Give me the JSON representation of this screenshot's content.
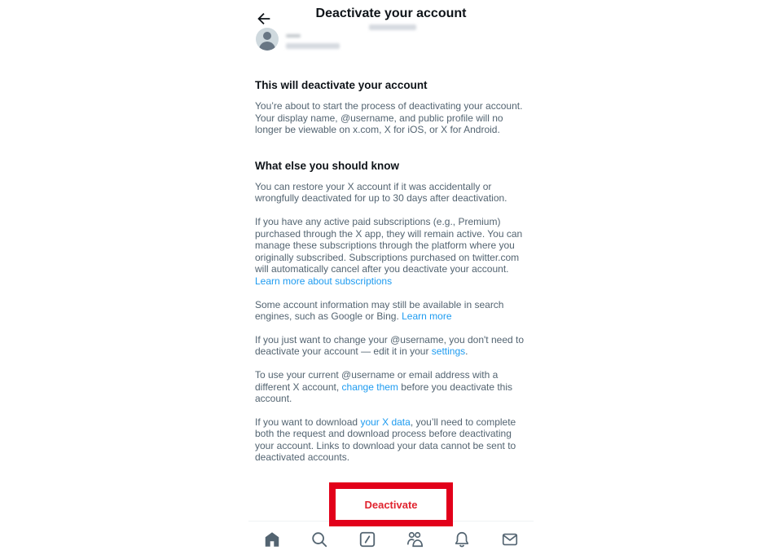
{
  "header": {
    "title": "Deactivate your account",
    "back_icon": "arrow-left-icon"
  },
  "account": {
    "avatar_icon": "default-avatar-icon",
    "display_name": "(blurred)",
    "username": "(blurred)"
  },
  "section1": {
    "heading": "This will deactivate your account",
    "body": "You’re about to start the process of deactivating your account. Your display name, @username, and public profile will no longer be viewable on x.com, X for iOS, or X for Android."
  },
  "section2": {
    "heading": "What else you should know",
    "p1": "You can restore your X account if it was accidentally or wrongfully deactivated for up to 30 days after deactivation.",
    "p2": "If you have any active paid subscriptions (e.g., Premium) purchased through the X app, they will remain active. You can manage these subscriptions through the platform where you originally subscribed. Subscriptions purchased on twitter.com will automatically cancel after you deactivate your account.",
    "p2_link": "Learn more about subscriptions",
    "p3": "Some account information may still be available in search engines, such as Google or Bing.",
    "p3_link": "Learn more",
    "p4_before": "If you just want to change your @username, you don't need to deactivate your account — edit it in your",
    "p4_link": "settings",
    "p4_after": ".",
    "p5_before": "To use your current @username or email address with a different X account,",
    "p5_link": "change them",
    "p5_after": "before you deactivate this account.",
    "p6_before": "If you want to download",
    "p6_link": "your X data",
    "p6_after": ", you’ll need to complete both the request and download process before deactivating your account. Links to download your data cannot be sent to deactivated accounts."
  },
  "actions": {
    "deactivate_label": "Deactivate",
    "highlight_color": "#e2001a",
    "button_text_color": "#e0242f"
  },
  "bottom_nav": {
    "items": [
      "home-icon",
      "search-icon",
      "compose-icon",
      "communities-icon",
      "notifications-icon",
      "messages-icon"
    ]
  }
}
